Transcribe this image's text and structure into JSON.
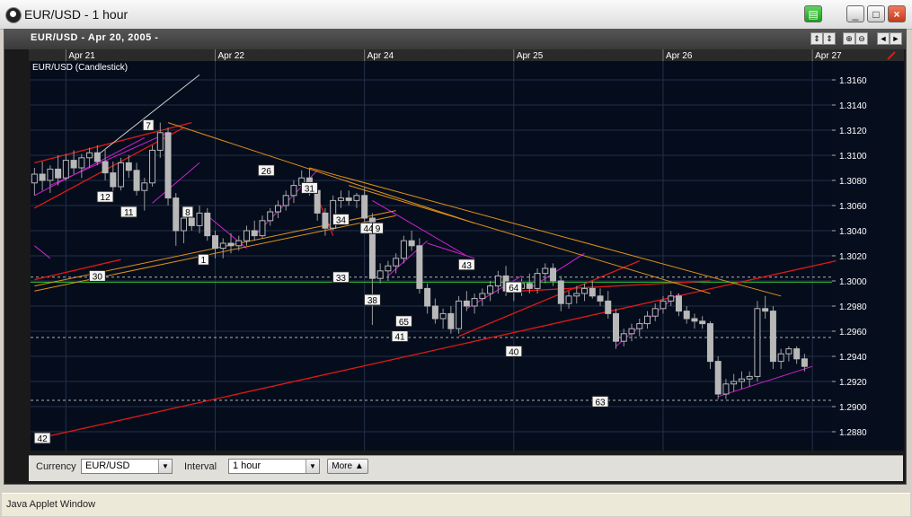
{
  "window": {
    "title": "EUR/USD - 1 hour",
    "buttons": [
      "▤",
      "_",
      "□",
      "×"
    ]
  },
  "chart_header": {
    "title": "EUR/USD - Apr 20, 2005 -",
    "series_label": "EUR/USD (Candlestick)",
    "controls": [
      "⇕",
      "⇕",
      "⊕",
      "⊖",
      "◄",
      "►"
    ]
  },
  "colors": {
    "background": "#050d1c",
    "grid": "#24304a",
    "up_candle": "#b8b8b8",
    "down_candle": "#b8b8b8",
    "red_line": "#e01818",
    "magenta_line": "#d020d0",
    "orange_line": "#e09018",
    "green_line": "#30c030",
    "white_line": "#cfcfcf"
  },
  "chart_data": {
    "type": "candlestick",
    "title": "EUR/USD (Candlestick)",
    "date_labels": [
      {
        "label": "Apr 21",
        "index": 4
      },
      {
        "label": "Apr 22",
        "index": 23
      },
      {
        "label": "Apr 24",
        "index": 42
      },
      {
        "label": "Apr 25",
        "index": 61
      },
      {
        "label": "Apr 26",
        "index": 80
      },
      {
        "label": "Apr 27",
        "index": 99
      }
    ],
    "y_ticks": [
      "1.3160",
      "1.3140",
      "1.3120",
      "1.3100",
      "1.3080",
      "1.3060",
      "1.3040",
      "1.3020",
      "1.3000",
      "1.2980",
      "1.2960",
      "1.2940",
      "1.2920",
      "1.2900",
      "1.2880"
    ],
    "y_tick_values": [
      1.316,
      1.314,
      1.312,
      1.31,
      1.308,
      1.306,
      1.304,
      1.302,
      1.3,
      1.298,
      1.296,
      1.294,
      1.292,
      1.29,
      1.288
    ],
    "ylim": [
      1.2865,
      1.3175
    ],
    "n_slots": 102,
    "candles": [
      {
        "i": 0,
        "o": 1.3078,
        "h": 1.309,
        "l": 1.3068,
        "c": 1.3085
      },
      {
        "i": 1,
        "o": 1.3085,
        "h": 1.3095,
        "l": 1.3072,
        "c": 1.308
      },
      {
        "i": 2,
        "o": 1.308,
        "h": 1.3092,
        "l": 1.307,
        "c": 1.3089
      },
      {
        "i": 3,
        "o": 1.3089,
        "h": 1.31,
        "l": 1.3076,
        "c": 1.3082
      },
      {
        "i": 4,
        "o": 1.3082,
        "h": 1.3101,
        "l": 1.308,
        "c": 1.3096
      },
      {
        "i": 5,
        "o": 1.3096,
        "h": 1.3104,
        "l": 1.3085,
        "c": 1.309
      },
      {
        "i": 6,
        "o": 1.309,
        "h": 1.3101,
        "l": 1.3082,
        "c": 1.3098
      },
      {
        "i": 7,
        "o": 1.3098,
        "h": 1.3106,
        "l": 1.309,
        "c": 1.3102
      },
      {
        "i": 8,
        "o": 1.3102,
        "h": 1.3108,
        "l": 1.3092,
        "c": 1.3095
      },
      {
        "i": 9,
        "o": 1.3095,
        "h": 1.3105,
        "l": 1.308,
        "c": 1.3086
      },
      {
        "i": 10,
        "o": 1.3086,
        "h": 1.3095,
        "l": 1.307,
        "c": 1.3075
      },
      {
        "i": 11,
        "o": 1.3075,
        "h": 1.3098,
        "l": 1.3072,
        "c": 1.3094
      },
      {
        "i": 12,
        "o": 1.3094,
        "h": 1.31,
        "l": 1.3082,
        "c": 1.3088
      },
      {
        "i": 13,
        "o": 1.3088,
        "h": 1.3094,
        "l": 1.3068,
        "c": 1.3072
      },
      {
        "i": 14,
        "o": 1.3072,
        "h": 1.3082,
        "l": 1.3056,
        "c": 1.3078
      },
      {
        "i": 15,
        "o": 1.3078,
        "h": 1.3108,
        "l": 1.3075,
        "c": 1.3104
      },
      {
        "i": 16,
        "o": 1.3104,
        "h": 1.3126,
        "l": 1.3098,
        "c": 1.3118
      },
      {
        "i": 17,
        "o": 1.3118,
        "h": 1.3122,
        "l": 1.306,
        "c": 1.3066
      },
      {
        "i": 18,
        "o": 1.3066,
        "h": 1.307,
        "l": 1.3028,
        "c": 1.304
      },
      {
        "i": 19,
        "o": 1.304,
        "h": 1.3054,
        "l": 1.303,
        "c": 1.305
      },
      {
        "i": 20,
        "o": 1.305,
        "h": 1.3058,
        "l": 1.304,
        "c": 1.3044
      },
      {
        "i": 21,
        "o": 1.3044,
        "h": 1.306,
        "l": 1.3038,
        "c": 1.3054
      },
      {
        "i": 22,
        "o": 1.3054,
        "h": 1.3058,
        "l": 1.3032,
        "c": 1.3036
      },
      {
        "i": 23,
        "o": 1.3036,
        "h": 1.304,
        "l": 1.3018,
        "c": 1.3026
      },
      {
        "i": 24,
        "o": 1.3026,
        "h": 1.3034,
        "l": 1.3018,
        "c": 1.303
      },
      {
        "i": 25,
        "o": 1.303,
        "h": 1.3038,
        "l": 1.3022,
        "c": 1.3028
      },
      {
        "i": 26,
        "o": 1.3028,
        "h": 1.3036,
        "l": 1.3024,
        "c": 1.3032
      },
      {
        "i": 27,
        "o": 1.3032,
        "h": 1.3044,
        "l": 1.3028,
        "c": 1.304
      },
      {
        "i": 28,
        "o": 1.304,
        "h": 1.3048,
        "l": 1.3032,
        "c": 1.3036
      },
      {
        "i": 29,
        "o": 1.3036,
        "h": 1.3052,
        "l": 1.3034,
        "c": 1.3048
      },
      {
        "i": 30,
        "o": 1.3048,
        "h": 1.3058,
        "l": 1.3044,
        "c": 1.3055
      },
      {
        "i": 31,
        "o": 1.3055,
        "h": 1.3064,
        "l": 1.305,
        "c": 1.306
      },
      {
        "i": 32,
        "o": 1.306,
        "h": 1.3072,
        "l": 1.3056,
        "c": 1.3068
      },
      {
        "i": 33,
        "o": 1.3068,
        "h": 1.308,
        "l": 1.3062,
        "c": 1.3076
      },
      {
        "i": 34,
        "o": 1.3076,
        "h": 1.3088,
        "l": 1.307,
        "c": 1.3082
      },
      {
        "i": 35,
        "o": 1.3082,
        "h": 1.309,
        "l": 1.3068,
        "c": 1.3072
      },
      {
        "i": 36,
        "o": 1.3072,
        "h": 1.3076,
        "l": 1.3048,
        "c": 1.3054
      },
      {
        "i": 37,
        "o": 1.3054,
        "h": 1.3058,
        "l": 1.3036,
        "c": 1.3042
      },
      {
        "i": 38,
        "o": 1.3042,
        "h": 1.3068,
        "l": 1.304,
        "c": 1.3064
      },
      {
        "i": 39,
        "o": 1.3064,
        "h": 1.3072,
        "l": 1.3058,
        "c": 1.3066
      },
      {
        "i": 40,
        "o": 1.3066,
        "h": 1.3072,
        "l": 1.306,
        "c": 1.3064
      },
      {
        "i": 41,
        "o": 1.3064,
        "h": 1.307,
        "l": 1.3058,
        "c": 1.3068
      },
      {
        "i": 42,
        "o": 1.3068,
        "h": 1.3074,
        "l": 1.3046,
        "c": 1.305
      },
      {
        "i": 43,
        "o": 1.305,
        "h": 1.3054,
        "l": 1.2965,
        "c": 1.3002
      },
      {
        "i": 44,
        "o": 1.3002,
        "h": 1.3014,
        "l": 1.2998,
        "c": 1.3008
      },
      {
        "i": 45,
        "o": 1.3008,
        "h": 1.3016,
        "l": 1.3,
        "c": 1.3012
      },
      {
        "i": 46,
        "o": 1.3012,
        "h": 1.3022,
        "l": 1.3006,
        "c": 1.3018
      },
      {
        "i": 47,
        "o": 1.3018,
        "h": 1.3036,
        "l": 1.3014,
        "c": 1.3032
      },
      {
        "i": 48,
        "o": 1.3032,
        "h": 1.304,
        "l": 1.3024,
        "c": 1.3028
      },
      {
        "i": 49,
        "o": 1.3028,
        "h": 1.3034,
        "l": 1.299,
        "c": 1.2994
      },
      {
        "i": 50,
        "o": 1.2994,
        "h": 1.2998,
        "l": 1.2974,
        "c": 1.298
      },
      {
        "i": 51,
        "o": 1.298,
        "h": 1.2986,
        "l": 1.2966,
        "c": 1.297
      },
      {
        "i": 52,
        "o": 1.297,
        "h": 1.2978,
        "l": 1.2962,
        "c": 1.2974
      },
      {
        "i": 53,
        "o": 1.2974,
        "h": 1.298,
        "l": 1.2958,
        "c": 1.2962
      },
      {
        "i": 54,
        "o": 1.2962,
        "h": 1.2988,
        "l": 1.2958,
        "c": 1.2984
      },
      {
        "i": 55,
        "o": 1.2984,
        "h": 1.2992,
        "l": 1.2976,
        "c": 1.298
      },
      {
        "i": 56,
        "o": 1.298,
        "h": 1.299,
        "l": 1.2974,
        "c": 1.2986
      },
      {
        "i": 57,
        "o": 1.2986,
        "h": 1.2994,
        "l": 1.298,
        "c": 1.299
      },
      {
        "i": 58,
        "o": 1.299,
        "h": 1.3,
        "l": 1.2984,
        "c": 1.2996
      },
      {
        "i": 59,
        "o": 1.2996,
        "h": 1.3008,
        "l": 1.299,
        "c": 1.3004
      },
      {
        "i": 60,
        "o": 1.3004,
        "h": 1.3012,
        "l": 1.2988,
        "c": 1.2992
      },
      {
        "i": 61,
        "o": 1.2992,
        "h": 1.2998,
        "l": 1.2984,
        "c": 1.2994
      },
      {
        "i": 62,
        "o": 1.2994,
        "h": 1.3002,
        "l": 1.2988,
        "c": 1.2998
      },
      {
        "i": 63,
        "o": 1.2998,
        "h": 1.3006,
        "l": 1.299,
        "c": 1.2994
      },
      {
        "i": 64,
        "o": 1.2994,
        "h": 1.301,
        "l": 1.299,
        "c": 1.3006
      },
      {
        "i": 65,
        "o": 1.3006,
        "h": 1.3014,
        "l": 1.2998,
        "c": 1.301
      },
      {
        "i": 66,
        "o": 1.301,
        "h": 1.3014,
        "l": 1.2996,
        "c": 1.3
      },
      {
        "i": 67,
        "o": 1.3,
        "h": 1.3004,
        "l": 1.2976,
        "c": 1.2982
      },
      {
        "i": 68,
        "o": 1.2982,
        "h": 1.2992,
        "l": 1.2978,
        "c": 1.2988
      },
      {
        "i": 69,
        "o": 1.2988,
        "h": 1.2996,
        "l": 1.2982,
        "c": 1.299
      },
      {
        "i": 70,
        "o": 1.299,
        "h": 1.2998,
        "l": 1.2984,
        "c": 1.2994
      },
      {
        "i": 71,
        "o": 1.2994,
        "h": 1.3,
        "l": 1.2986,
        "c": 1.2988
      },
      {
        "i": 72,
        "o": 1.2988,
        "h": 1.2994,
        "l": 1.298,
        "c": 1.2984
      },
      {
        "i": 73,
        "o": 1.2984,
        "h": 1.2992,
        "l": 1.297,
        "c": 1.2974
      },
      {
        "i": 74,
        "o": 1.2974,
        "h": 1.2978,
        "l": 1.2946,
        "c": 1.2952
      },
      {
        "i": 75,
        "o": 1.2952,
        "h": 1.2962,
        "l": 1.2948,
        "c": 1.2958
      },
      {
        "i": 76,
        "o": 1.2958,
        "h": 1.2966,
        "l": 1.2952,
        "c": 1.2962
      },
      {
        "i": 77,
        "o": 1.2962,
        "h": 1.297,
        "l": 1.2956,
        "c": 1.2966
      },
      {
        "i": 78,
        "o": 1.2966,
        "h": 1.2976,
        "l": 1.2962,
        "c": 1.2972
      },
      {
        "i": 79,
        "o": 1.2972,
        "h": 1.2982,
        "l": 1.2968,
        "c": 1.2978
      },
      {
        "i": 80,
        "o": 1.2978,
        "h": 1.2988,
        "l": 1.2974,
        "c": 1.2984
      },
      {
        "i": 81,
        "o": 1.2984,
        "h": 1.2992,
        "l": 1.298,
        "c": 1.2988
      },
      {
        "i": 82,
        "o": 1.2988,
        "h": 1.299,
        "l": 1.2972,
        "c": 1.2976
      },
      {
        "i": 83,
        "o": 1.2976,
        "h": 1.298,
        "l": 1.2966,
        "c": 1.297
      },
      {
        "i": 84,
        "o": 1.297,
        "h": 1.2974,
        "l": 1.2962,
        "c": 1.2968
      },
      {
        "i": 85,
        "o": 1.2968,
        "h": 1.2972,
        "l": 1.2962,
        "c": 1.2966
      },
      {
        "i": 86,
        "o": 1.2966,
        "h": 1.2968,
        "l": 1.293,
        "c": 1.2936
      },
      {
        "i": 87,
        "o": 1.2936,
        "h": 1.294,
        "l": 1.2906,
        "c": 1.291
      },
      {
        "i": 88,
        "o": 1.291,
        "h": 1.2922,
        "l": 1.2906,
        "c": 1.2918
      },
      {
        "i": 89,
        "o": 1.2918,
        "h": 1.2926,
        "l": 1.2912,
        "c": 1.292
      },
      {
        "i": 90,
        "o": 1.292,
        "h": 1.2928,
        "l": 1.2914,
        "c": 1.2922
      },
      {
        "i": 91,
        "o": 1.2922,
        "h": 1.2928,
        "l": 1.2916,
        "c": 1.2924
      },
      {
        "i": 92,
        "o": 1.2924,
        "h": 1.2984,
        "l": 1.292,
        "c": 1.2978
      },
      {
        "i": 93,
        "o": 1.2978,
        "h": 1.2988,
        "l": 1.297,
        "c": 1.2976
      },
      {
        "i": 94,
        "o": 1.2976,
        "h": 1.298,
        "l": 1.293,
        "c": 1.2936
      },
      {
        "i": 95,
        "o": 1.2936,
        "h": 1.2946,
        "l": 1.293,
        "c": 1.2942
      },
      {
        "i": 96,
        "o": 1.2942,
        "h": 1.2948,
        "l": 1.2936,
        "c": 1.2946
      },
      {
        "i": 97,
        "o": 1.2946,
        "h": 1.2948,
        "l": 1.2934,
        "c": 1.2938
      },
      {
        "i": 98,
        "o": 1.2938,
        "h": 1.2942,
        "l": 1.2928,
        "c": 1.2932
      }
    ],
    "h_levels": [
      {
        "y": 1.3003,
        "style": "dashed",
        "color": "#b0b0b0"
      },
      {
        "y": 1.2999,
        "style": "solid",
        "color": "#30c030"
      },
      {
        "y": 1.2955,
        "style": "dashed",
        "color": "#b0b0b0"
      },
      {
        "y": 1.2905,
        "style": "dashed",
        "color": "#b0b0b0"
      }
    ],
    "trendlines": [
      {
        "c": "red",
        "x1": 0,
        "y1": 1.3094,
        "x2": 20,
        "y2": 1.3126
      },
      {
        "c": "red",
        "x1": 0,
        "y1": 1.3058,
        "x2": 19,
        "y2": 1.3122
      },
      {
        "c": "red",
        "x1": 0,
        "y1": 1.3001,
        "x2": 11,
        "y2": 1.3017
      },
      {
        "c": "red",
        "x1": 0,
        "y1": 1.2874,
        "x2": 102,
        "y2": 1.3016
      },
      {
        "c": "red",
        "x1": 54,
        "y1": 1.2956,
        "x2": 77,
        "y2": 1.3016
      },
      {
        "c": "red",
        "x1": 62,
        "y1": 1.2992,
        "x2": 86,
        "y2": 1.3
      },
      {
        "c": "red",
        "x1": 35,
        "y1": 1.3082,
        "x2": 38,
        "y2": 1.3036
      },
      {
        "c": "magenta",
        "x1": 0,
        "y1": 1.3068,
        "x2": 14,
        "y2": 1.3114
      },
      {
        "c": "magenta",
        "x1": 2,
        "y1": 1.3076,
        "x2": 17,
        "y2": 1.3118
      },
      {
        "c": "magenta",
        "x1": 15,
        "y1": 1.3062,
        "x2": 21,
        "y2": 1.3094
      },
      {
        "c": "magenta",
        "x1": 22,
        "y1": 1.3052,
        "x2": 27,
        "y2": 1.3026
      },
      {
        "c": "magenta",
        "x1": 28,
        "y1": 1.3036,
        "x2": 36,
        "y2": 1.3088
      },
      {
        "c": "magenta",
        "x1": 43,
        "y1": 1.3064,
        "x2": 55,
        "y2": 1.302
      },
      {
        "c": "magenta",
        "x1": 45,
        "y1": 1.3004,
        "x2": 50,
        "y2": 1.3032
      },
      {
        "c": "magenta",
        "x1": 50,
        "y1": 1.303,
        "x2": 56,
        "y2": 1.3018
      },
      {
        "c": "magenta",
        "x1": 55,
        "y1": 1.2978,
        "x2": 62,
        "y2": 1.3004
      },
      {
        "c": "magenta",
        "x1": 63,
        "y1": 1.2994,
        "x2": 70,
        "y2": 1.3022
      },
      {
        "c": "magenta",
        "x1": 74,
        "y1": 1.2948,
        "x2": 82,
        "y2": 1.299
      },
      {
        "c": "magenta",
        "x1": 87,
        "y1": 1.2908,
        "x2": 99,
        "y2": 1.2932
      },
      {
        "c": "magenta",
        "x1": 0,
        "y1": 1.3028,
        "x2": 2,
        "y2": 1.3018
      },
      {
        "c": "orange",
        "x1": 17,
        "y1": 1.3126,
        "x2": 56,
        "y2": 1.3046
      },
      {
        "c": "orange",
        "x1": 35,
        "y1": 1.309,
        "x2": 95,
        "y2": 1.2988
      },
      {
        "c": "orange",
        "x1": 0,
        "y1": 1.2992,
        "x2": 46,
        "y2": 1.3052
      },
      {
        "c": "orange",
        "x1": 0,
        "y1": 1.2996,
        "x2": 46,
        "y2": 1.3056
      },
      {
        "c": "orange",
        "x1": 40,
        "y1": 1.3076,
        "x2": 86,
        "y2": 1.299
      },
      {
        "c": "white",
        "x1": 8,
        "y1": 1.31,
        "x2": 21,
        "y2": 1.3164
      }
    ],
    "markers": [
      {
        "label": "7",
        "i": 14.5,
        "y": 1.3124
      },
      {
        "label": "12",
        "i": 9,
        "y": 1.3067
      },
      {
        "label": "11",
        "i": 12,
        "y": 1.3055
      },
      {
        "label": "8",
        "i": 19.5,
        "y": 1.3055
      },
      {
        "label": "1",
        "i": 21.5,
        "y": 1.3017
      },
      {
        "label": "30",
        "i": 8,
        "y": 1.3004
      },
      {
        "label": "26",
        "i": 29.5,
        "y": 1.3088
      },
      {
        "label": "31",
        "i": 35,
        "y": 1.3074
      },
      {
        "label": "34",
        "i": 39,
        "y": 1.3049
      },
      {
        "label": "33",
        "i": 39,
        "y": 1.3003
      },
      {
        "label": "44",
        "i": 42.5,
        "y": 1.3042
      },
      {
        "label": "9",
        "i": 43.7,
        "y": 1.3042
      },
      {
        "label": "38",
        "i": 43,
        "y": 1.2985
      },
      {
        "label": "65",
        "i": 47,
        "y": 1.2968
      },
      {
        "label": "41",
        "i": 46.5,
        "y": 1.2956
      },
      {
        "label": "43",
        "i": 55,
        "y": 1.3013
      },
      {
        "label": "64",
        "i": 61,
        "y": 1.2995
      },
      {
        "label": "40",
        "i": 61,
        "y": 1.2944
      },
      {
        "label": "63",
        "i": 72,
        "y": 1.2904
      },
      {
        "label": "42",
        "i": 1,
        "y": 1.2875
      }
    ]
  },
  "controls_bar": {
    "currency_label": "Currency",
    "currency_value": "EUR/USD",
    "interval_label": "Interval",
    "interval_value": "1 hour",
    "more_label": "More ▲"
  },
  "status": {
    "text": "Java Applet Window"
  }
}
